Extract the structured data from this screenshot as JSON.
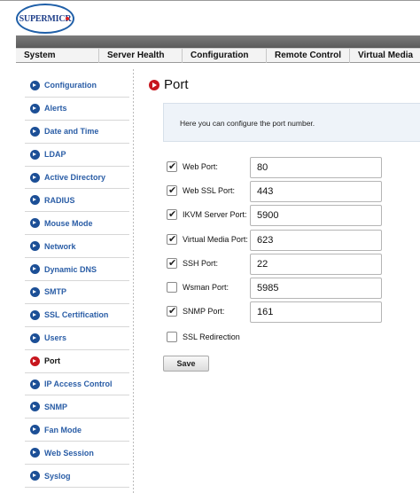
{
  "brand": {
    "logo_text": "SUPERMICR"
  },
  "topnav": {
    "tabs": [
      {
        "label": "System"
      },
      {
        "label": "Server Health"
      },
      {
        "label": "Configuration"
      },
      {
        "label": "Remote Control"
      },
      {
        "label": "Virtual Media"
      }
    ]
  },
  "sidebar": {
    "items": [
      {
        "label": "Configuration",
        "active": false
      },
      {
        "label": "Alerts",
        "active": false
      },
      {
        "label": "Date and Time",
        "active": false
      },
      {
        "label": "LDAP",
        "active": false
      },
      {
        "label": "Active Directory",
        "active": false
      },
      {
        "label": "RADIUS",
        "active": false
      },
      {
        "label": "Mouse Mode",
        "active": false
      },
      {
        "label": "Network",
        "active": false
      },
      {
        "label": "Dynamic DNS",
        "active": false
      },
      {
        "label": "SMTP",
        "active": false
      },
      {
        "label": "SSL Certification",
        "active": false
      },
      {
        "label": "Users",
        "active": false
      },
      {
        "label": "Port",
        "active": true
      },
      {
        "label": "IP Access Control",
        "active": false
      },
      {
        "label": "SNMP",
        "active": false
      },
      {
        "label": "Fan Mode",
        "active": false
      },
      {
        "label": "Web Session",
        "active": false
      },
      {
        "label": "Syslog",
        "active": false
      }
    ]
  },
  "page": {
    "title": "Port",
    "info": "Here you can configure the port number."
  },
  "ports": [
    {
      "label": "Web Port:",
      "checked": true,
      "value": "80"
    },
    {
      "label": "Web SSL Port:",
      "checked": true,
      "value": "443"
    },
    {
      "label": "IKVM Server Port:",
      "checked": true,
      "value": "5900"
    },
    {
      "label": "Virtual Media Port:",
      "checked": true,
      "value": "623"
    },
    {
      "label": "SSH Port:",
      "checked": true,
      "value": "22"
    },
    {
      "label": "Wsman Port:",
      "checked": false,
      "value": "5985"
    },
    {
      "label": "SNMP Port:",
      "checked": true,
      "value": "161"
    }
  ],
  "ssl_redirection": {
    "label": "SSL Redirection",
    "checked": false
  },
  "actions": {
    "save_label": "Save"
  }
}
